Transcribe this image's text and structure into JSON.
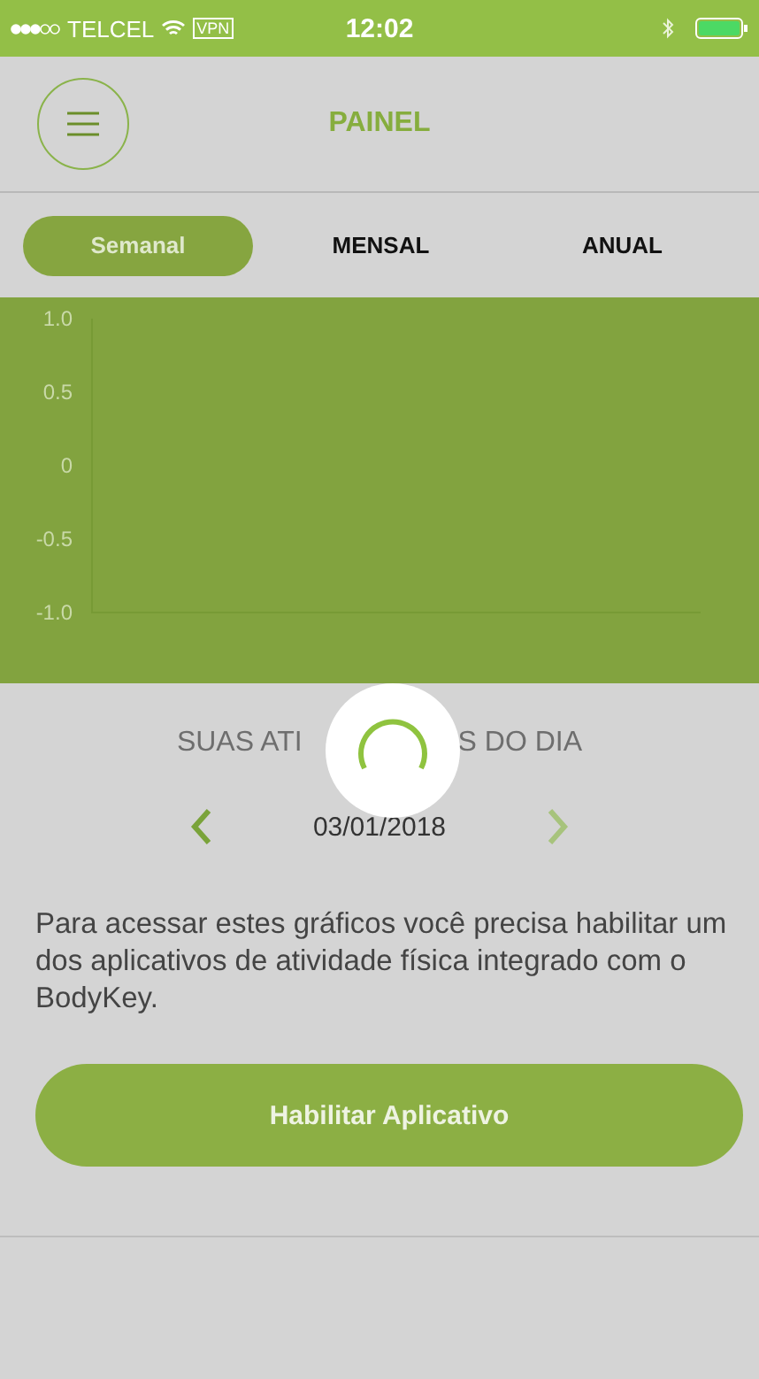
{
  "status_bar": {
    "carrier": "TELCEL",
    "vpn": "VPN",
    "time": "12:02"
  },
  "header": {
    "title": "PAINEL"
  },
  "tabs": [
    {
      "label": "Semanal",
      "selected": true
    },
    {
      "label": "MENSAL",
      "selected": false
    },
    {
      "label": "ANUAL",
      "selected": false
    }
  ],
  "chart": {
    "y_axis_labels": [
      "1.0",
      "0.5",
      "0",
      "-0.5",
      "-1.0"
    ]
  },
  "activities": {
    "title_parts": [
      "SUAS ATI",
      "S DO DIA"
    ],
    "loading": true,
    "date": "03/01/2018",
    "prev_disabled": false,
    "next_disabled": true
  },
  "message": "Para acessar estes gráficos você precisa habilitar um dos aplicativos de atividade física integrado com o BodyKey.",
  "button": "Habilitar Aplicativo"
}
